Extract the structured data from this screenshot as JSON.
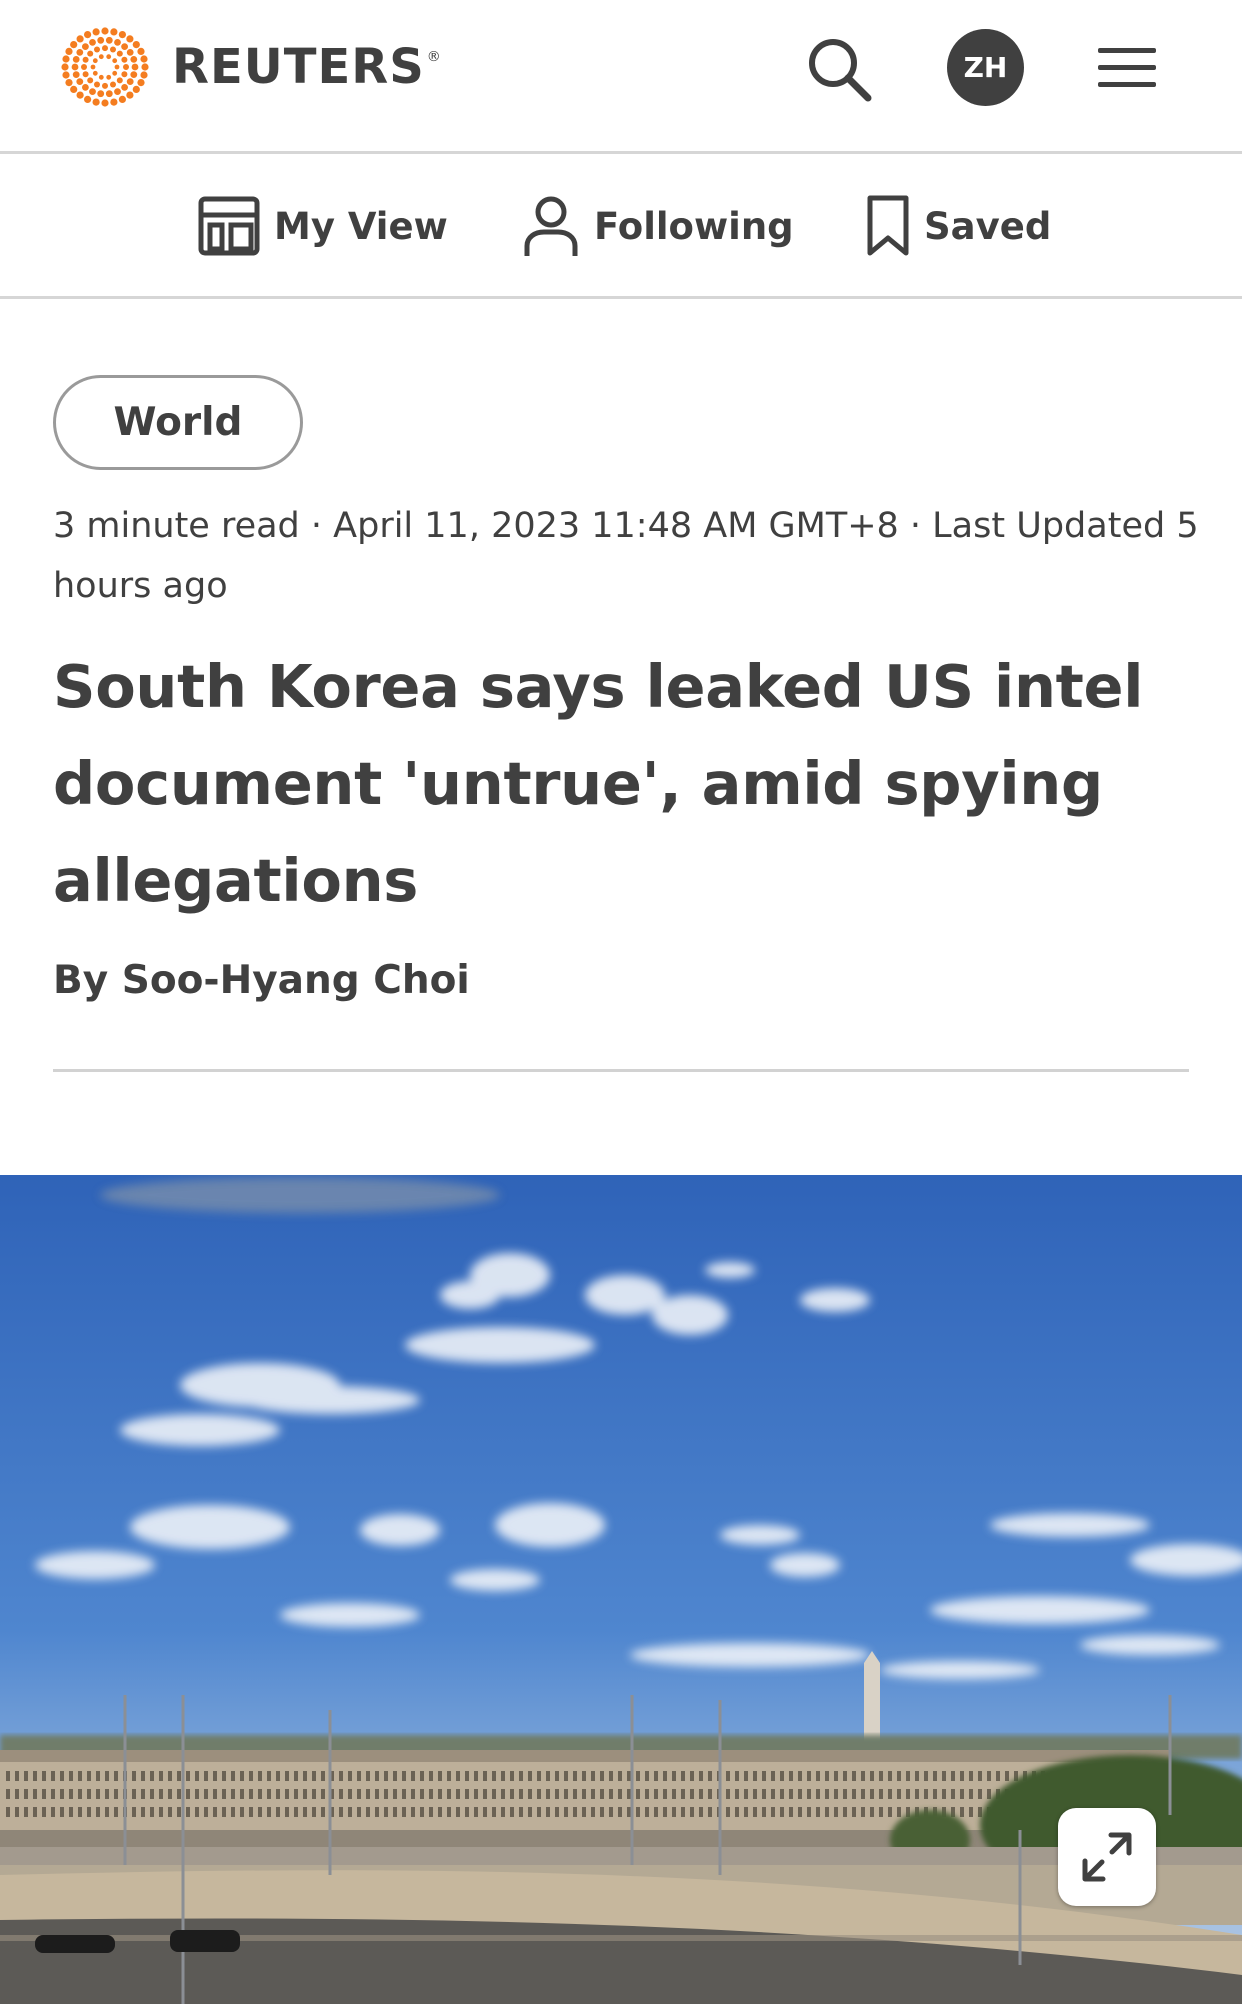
{
  "header": {
    "brand": "REUTERS",
    "brand_mark": "®",
    "brand_color": "#f47d20",
    "avatar_initials": "ZH",
    "icons": [
      "search-icon",
      "hamburger-menu-icon"
    ]
  },
  "subnav": {
    "items": [
      {
        "label": "My View",
        "icon": "layout-icon"
      },
      {
        "label": "Following",
        "icon": "person-icon"
      },
      {
        "label": "Saved",
        "icon": "bookmark-icon"
      }
    ]
  },
  "article": {
    "section_tag": "World",
    "meta": "3 minute read · April 11, 2023 11:48 AM GMT+8 · Last Updated 5 hours ago",
    "headline": "South Korea says leaked US intel document 'untrue', amid spying allegations",
    "byline": "By Soo-Hyang Choi"
  },
  "hero": {
    "expand_icon": "expand-icon",
    "sky_color": "#3d74c4"
  }
}
